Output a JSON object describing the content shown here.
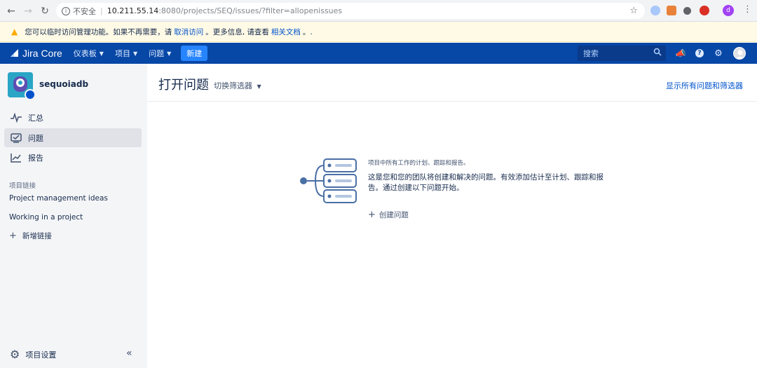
{
  "browser": {
    "insecure_label": "不安全",
    "url_host": "10.211.55.14",
    "url_rest": ":8080/projects/SEQ/issues/?filter=allopenissues"
  },
  "banner": {
    "text_before": "您可以临时访问管理功能。如果不再需要，请",
    "link1": "取消访问",
    "text_middle": "。更多信息, 请查看",
    "link2": "相关文档",
    "text_after": "。."
  },
  "topnav": {
    "logo": "Jira Core",
    "menu": [
      "仪表板",
      "项目",
      "问题"
    ],
    "create_label": "新建",
    "search_placeholder": "搜索"
  },
  "sidebar": {
    "project_name": "sequoiadb",
    "items": [
      {
        "label": "汇总",
        "icon": "activity-icon"
      },
      {
        "label": "问题",
        "icon": "issues-icon"
      },
      {
        "label": "报告",
        "icon": "chart-icon"
      }
    ],
    "links_heading": "项目链接",
    "links": [
      "Project management ideas",
      "Working in a project"
    ],
    "add_link_label": "新增链接",
    "settings_label": "项目设置"
  },
  "main": {
    "title": "打开问题",
    "filter_switch": "切换筛选器",
    "all_issues_link": "显示所有问题和筛选器",
    "empty_caption": "项目中所有工作的计划、跟踪和报告。",
    "empty_body": "这是您和您的团队将创建和解决的问题。有效添加估计至计划、跟踪和报告。通过创建以下问题开始。",
    "create_issue_label": "创建问题"
  },
  "colors": {
    "nav_bg": "#0747a6",
    "create_btn": "#2684ff",
    "banner_bg": "#fffae6",
    "link": "#0052cc"
  }
}
